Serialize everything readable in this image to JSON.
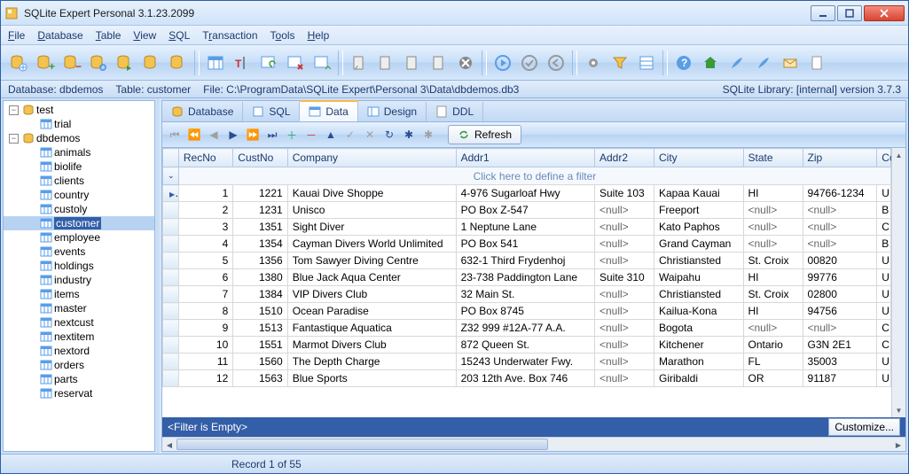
{
  "window": {
    "title": "SQLite Expert Personal 3.1.23.2099"
  },
  "menu": {
    "file": "File",
    "database": "Database",
    "table": "Table",
    "view": "View",
    "sql": "SQL",
    "transaction": "Transaction",
    "tools": "Tools",
    "help": "Help"
  },
  "status": {
    "database_label": "Database:",
    "database": "dbdemos",
    "table_label": "Table:",
    "table": "customer",
    "file_label": "File:",
    "file": "C:\\ProgramData\\SQLite Expert\\Personal 3\\Data\\dbdemos.db3",
    "lib": "SQLite Library: [internal] version 3.7.3"
  },
  "tree": {
    "root1": "test",
    "root1_child": "trial",
    "root2": "dbdemos",
    "tables": [
      "animals",
      "biolife",
      "clients",
      "country",
      "custoly",
      "customer",
      "employee",
      "events",
      "holdings",
      "industry",
      "items",
      "master",
      "nextcust",
      "nextitem",
      "nextord",
      "orders",
      "parts",
      "reservat"
    ],
    "selected": "customer"
  },
  "tabs": {
    "database": "Database",
    "sql": "SQL",
    "data": "Data",
    "design": "Design",
    "ddl": "DDL"
  },
  "nav": {
    "refresh": "Refresh"
  },
  "grid": {
    "columns": [
      "RecNo",
      "CustNo",
      "Company",
      "Addr1",
      "Addr2",
      "City",
      "State",
      "Zip",
      "Country"
    ],
    "filter_prompt": "Click here to define a filter",
    "rows": [
      {
        "RecNo": 1,
        "CustNo": 1221,
        "Company": "Kauai Dive Shoppe",
        "Addr1": "4-976 Sugarloaf Hwy",
        "Addr2": "Suite 103",
        "City": "Kapaa Kauai",
        "State": "HI",
        "Zip": "94766-1234",
        "Country": "US"
      },
      {
        "RecNo": 2,
        "CustNo": 1231,
        "Company": "Unisco",
        "Addr1": "PO Box Z-547",
        "Addr2": "<null>",
        "City": "Freeport",
        "State": "<null>",
        "Zip": "<null>",
        "Country": "Bahamas"
      },
      {
        "RecNo": 3,
        "CustNo": 1351,
        "Company": "Sight Diver",
        "Addr1": "1 Neptune Lane",
        "Addr2": "<null>",
        "City": "Kato Paphos",
        "State": "<null>",
        "Zip": "<null>",
        "Country": "Cyprus"
      },
      {
        "RecNo": 4,
        "CustNo": 1354,
        "Company": "Cayman Divers World Unlimited",
        "Addr1": "PO Box 541",
        "Addr2": "<null>",
        "City": "Grand Cayman",
        "State": "<null>",
        "Zip": "<null>",
        "Country": "British West Indies"
      },
      {
        "RecNo": 5,
        "CustNo": 1356,
        "Company": "Tom Sawyer Diving Centre",
        "Addr1": "632-1 Third Frydenhoj",
        "Addr2": "<null>",
        "City": "Christiansted",
        "State": "St. Croix",
        "Zip": "00820",
        "Country": "US Virgin Islands"
      },
      {
        "RecNo": 6,
        "CustNo": 1380,
        "Company": "Blue Jack Aqua Center",
        "Addr1": "23-738 Paddington Lane",
        "Addr2": "Suite 310",
        "City": "Waipahu",
        "State": "HI",
        "Zip": "99776",
        "Country": "US"
      },
      {
        "RecNo": 7,
        "CustNo": 1384,
        "Company": "VIP Divers Club",
        "Addr1": "32 Main St.",
        "Addr2": "<null>",
        "City": "Christiansted",
        "State": "St. Croix",
        "Zip": "02800",
        "Country": "US Virgin Islands"
      },
      {
        "RecNo": 8,
        "CustNo": 1510,
        "Company": "Ocean Paradise",
        "Addr1": "PO Box 8745",
        "Addr2": "<null>",
        "City": "Kailua-Kona",
        "State": "HI",
        "Zip": "94756",
        "Country": "US"
      },
      {
        "RecNo": 9,
        "CustNo": 1513,
        "Company": "Fantastique Aquatica",
        "Addr1": "Z32 999 #12A-77 A.A.",
        "Addr2": "<null>",
        "City": "Bogota",
        "State": "<null>",
        "Zip": "<null>",
        "Country": "Columbia"
      },
      {
        "RecNo": 10,
        "CustNo": 1551,
        "Company": "Marmot Divers Club",
        "Addr1": "872 Queen St.",
        "Addr2": "<null>",
        "City": "Kitchener",
        "State": "Ontario",
        "Zip": "G3N 2E1",
        "Country": "Canada"
      },
      {
        "RecNo": 11,
        "CustNo": 1560,
        "Company": "The Depth Charge",
        "Addr1": "15243 Underwater Fwy.",
        "Addr2": "<null>",
        "City": "Marathon",
        "State": "FL",
        "Zip": "35003",
        "Country": "US"
      },
      {
        "RecNo": 12,
        "CustNo": 1563,
        "Company": "Blue Sports",
        "Addr1": "203 12th Ave. Box 746",
        "Addr2": "<null>",
        "City": "Giribaldi",
        "State": "OR",
        "Zip": "91187",
        "Country": "US"
      }
    ],
    "filter_empty": "<Filter is Empty>",
    "customize": "Customize..."
  },
  "footer": {
    "record": "Record 1 of 55"
  }
}
